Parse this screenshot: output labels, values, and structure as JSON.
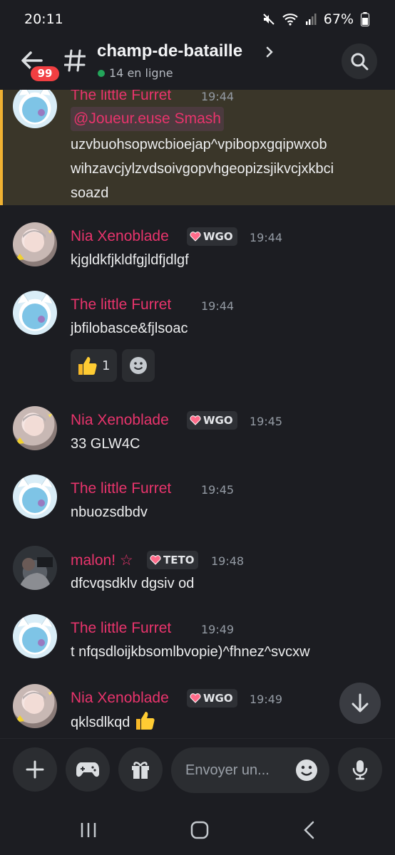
{
  "status_bar": {
    "time": "20:11",
    "battery": "67%"
  },
  "header": {
    "unread_badge": "99",
    "channel_name": "champ-de-bataille",
    "online_text": "14 en ligne"
  },
  "messages": [
    {
      "author": "The little Furret",
      "time": "19:44",
      "mention": "@Joueur.euse Smash",
      "text": "uzvbuohsopwcbioejap^vpibopxgqipwxobwihzavcjylzvdsoivgopvhgeopizsjikvcjxkbcisoazd",
      "line1": "uzvbuohsopwcbioejap^vpibopxgqipwxob",
      "line2": "wihzavcjylzvdsoivgopvhgeopizsjikvcjxkbci",
      "line3": "soazd"
    },
    {
      "author": "Nia Xenoblade",
      "role": "WGO",
      "time": "19:44",
      "text": "kjgldkfjkldfgjldfjdlgf"
    },
    {
      "author": "The little Furret",
      "time": "19:44",
      "text": "jbfilobasce&fjlsoac",
      "reaction_count": "1"
    },
    {
      "author": "Nia Xenoblade",
      "role": "WGO",
      "time": "19:45",
      "text": "33 GLW4C"
    },
    {
      "author": "The little Furret",
      "time": "19:45",
      "text": "nbuozsdbdv"
    },
    {
      "author": "malon! ☆",
      "role": "TETO",
      "time": "19:48",
      "text": "dfcvqsdklv dgsiv od"
    },
    {
      "author": "The little Furret",
      "time": "19:49",
      "text": "t nfqsdloijkbsomlbvopie)^fhnez^svcxw"
    },
    {
      "author": "Nia Xenoblade",
      "role": "WGO",
      "time": "19:49",
      "text": "qklsdlkqd"
    }
  ],
  "composer": {
    "placeholder": "Envoyer un..."
  },
  "colors": {
    "accent_name": "#e8346c",
    "online": "#23a55a",
    "badge": "#f23f42",
    "highlight_bar": "#f0b232"
  }
}
